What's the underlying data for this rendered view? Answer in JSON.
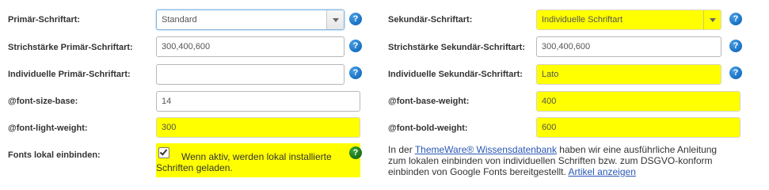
{
  "left": {
    "primary_font": {
      "label": "Primär-Schriftart:",
      "value": "Standard"
    },
    "primary_weight": {
      "label": "Strichstärke Primär-Schriftart:",
      "value": "300,400,600"
    },
    "custom_primary": {
      "label": "Individuelle Primär-Schriftart:",
      "value": ""
    },
    "font_size_base": {
      "label": "@font-size-base:",
      "value": "14"
    },
    "font_light_weight": {
      "label": "@font-light-weight:",
      "value": "300"
    },
    "local_fonts": {
      "label": "Fonts lokal einbinden:",
      "checked": true,
      "hint_line1": "Wenn aktiv, werden lokal installierte",
      "hint_line2": "Schriften geladen."
    }
  },
  "right": {
    "secondary_font": {
      "label": "Sekundär-Schriftart:",
      "value": "Individuelle Schriftart"
    },
    "secondary_weight": {
      "label": "Strichstärke Sekundär-Schriftart:",
      "value": "300,400,600"
    },
    "custom_secondary": {
      "label": "Individuelle Sekundär-Schriftart:",
      "value": "Lato"
    },
    "font_base_weight": {
      "label": "@font-base-weight:",
      "value": "400"
    },
    "font_bold_weight": {
      "label": "@font-bold-weight:",
      "value": "600"
    },
    "info": {
      "prefix": "In der ",
      "link_kb": "ThemeWare® Wissensdatenbank",
      "mid1": " haben wir eine ausführliche Anleitung",
      "line2": "zum lokalen einbinden von individuellen Schriften bzw. zum DSGVO-konform",
      "line3_prefix": "einbinden von Google Fonts bereitgestellt. ",
      "link_article": "Artikel anzeigen"
    }
  },
  "help_glyph": "?",
  "colors": {
    "highlight": "#ffff00",
    "help_blue": "#1770c2",
    "help_green": "#197019",
    "link": "#2a57b5"
  }
}
